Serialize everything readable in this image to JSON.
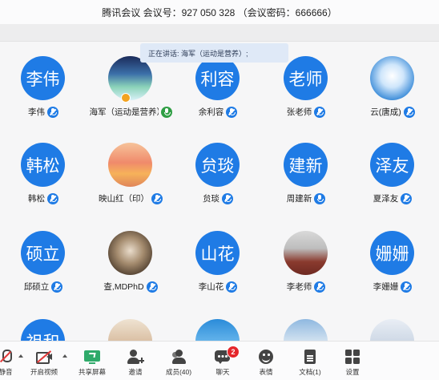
{
  "titlebar": {
    "title": "腾讯会议 会议号：927 050 328 （会议密码：666666）"
  },
  "speaker_banner": {
    "text": "正在讲话: 海军（运动是营养）;"
  },
  "participants": [
    {
      "avatar_text": "李伟",
      "name": "李伟",
      "photo": "",
      "mic": "muted"
    },
    {
      "avatar_text": "",
      "name": "海军（运动是营养）",
      "photo": "aurora",
      "mic": "active"
    },
    {
      "avatar_text": "利容",
      "name": "余利容",
      "photo": "",
      "mic": "muted"
    },
    {
      "avatar_text": "老师",
      "name": "张老师",
      "photo": "",
      "mic": "muted"
    },
    {
      "avatar_text": "",
      "name": "云(唐成)",
      "photo": "cloud",
      "mic": "muted"
    },
    {
      "avatar_text": "韩松",
      "name": "韩松",
      "photo": "",
      "mic": "muted"
    },
    {
      "avatar_text": "",
      "name": "映山红（印）",
      "photo": "sunset",
      "mic": "muted"
    },
    {
      "avatar_text": "贠琰",
      "name": "贠琰",
      "photo": "",
      "mic": "muted"
    },
    {
      "avatar_text": "建新",
      "name": "周建新",
      "photo": "",
      "mic": "on"
    },
    {
      "avatar_text": "泽友",
      "name": "夏泽友",
      "photo": "",
      "mic": "muted"
    },
    {
      "avatar_text": "硕立",
      "name": "邱硕立",
      "photo": "",
      "mic": "muted"
    },
    {
      "avatar_text": "",
      "name": "查,MDPhD",
      "photo": "mask",
      "mic": "muted"
    },
    {
      "avatar_text": "山花",
      "name": "李山花",
      "photo": "",
      "mic": "muted"
    },
    {
      "avatar_text": "",
      "name": "李老师",
      "photo": "stage",
      "mic": "muted"
    },
    {
      "avatar_text": "姗姗",
      "name": "李姗姗",
      "photo": "",
      "mic": "muted"
    },
    {
      "avatar_text": "祖和",
      "name": "",
      "photo": "",
      "mic": ""
    },
    {
      "avatar_text": "",
      "name": "",
      "photo": "flower",
      "mic": ""
    },
    {
      "avatar_text": "",
      "name": "",
      "photo": "sky",
      "mic": ""
    },
    {
      "avatar_text": "",
      "name": "",
      "photo": "snow",
      "mic": ""
    },
    {
      "avatar_text": "",
      "name": "",
      "photo": "people",
      "mic": ""
    }
  ],
  "toolbar": {
    "mute": "静音",
    "video": "开启视频",
    "share": "共享屏幕",
    "invite": "邀请",
    "members": "成员(40)",
    "chat": "聊天",
    "chat_badge": "2",
    "emoji": "表情",
    "docs": "文档(1)",
    "settings": "设置"
  },
  "colors": {
    "avatar_blue": "#1f7be5",
    "badge_red": "#e5262b",
    "share_green": "#2faa6a"
  }
}
